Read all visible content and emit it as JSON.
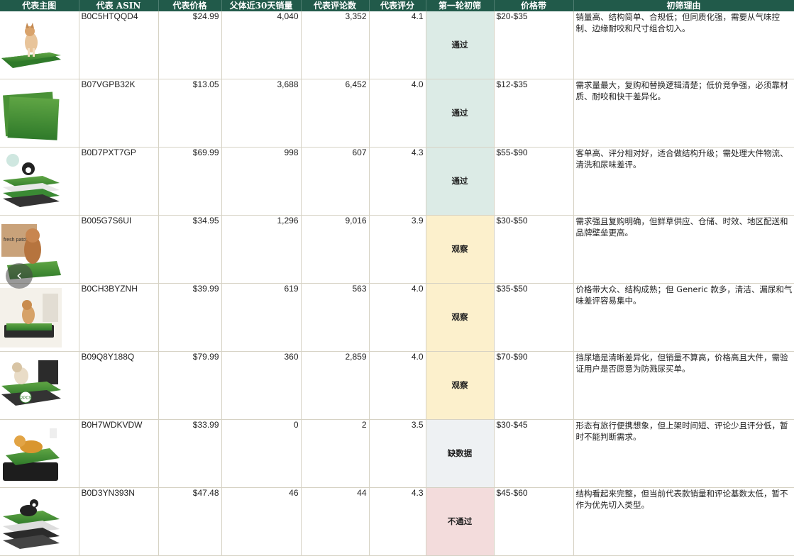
{
  "headers": [
    "代表主图",
    "代表 ASIN",
    "代表价格",
    "父体近30天销量",
    "代表评论数",
    "代表评分",
    "第一轮初筛",
    "价格带",
    "初筛理由"
  ],
  "status_colors": {
    "pass": "#dcebe6",
    "watch": "#fcf0cc",
    "missing": "#eef1f3",
    "fail": "#f3dcdc"
  },
  "nav": {
    "prev_symbol": "‹"
  },
  "rows": [
    {
      "image": "dog-on-grass-pad",
      "asin": "B0C5HTQQD4",
      "price": "$24.99",
      "sales": "4,040",
      "reviews": "3,352",
      "rating": "4.1",
      "status": "通过",
      "status_type": "pass",
      "price_band": "$20-$35",
      "reason": "销量高、结构简单、合规低；但同质化强，需要从气味控制、边缘耐咬和尺寸组合切入。"
    },
    {
      "image": "two-grass-mats",
      "asin": "B07VGPB32K",
      "price": "$13.05",
      "sales": "3,688",
      "reviews": "6,452",
      "rating": "4.0",
      "status": "通过",
      "status_type": "pass",
      "price_band": "$12-$35",
      "reason": "需求量最大，复购和替换逻辑清楚；低价竞争强，必须靠材质、耐咬和快干差异化。"
    },
    {
      "image": "layered-potty-system",
      "asin": "B0D7PXT7GP",
      "price": "$69.99",
      "sales": "998",
      "reviews": "607",
      "rating": "4.3",
      "status": "通过",
      "status_type": "pass",
      "price_band": "$55-$90",
      "reason": "客单高、评分相对好，适合做结构升级；需处理大件物流、清洗和尿味差评。"
    },
    {
      "image": "fresh-patch-box",
      "asin": "B005G7S6UI",
      "price": "$34.95",
      "sales": "1,296",
      "reviews": "9,016",
      "rating": "3.9",
      "status": "观察",
      "status_type": "watch",
      "price_band": "$30-$50",
      "reason": "需求强且复购明确，但鲜草供应、仓储、时效、地区配送和品牌壁垒更高。"
    },
    {
      "image": "dog-on-tray-indoor",
      "asin": "B0CH3BYZNH",
      "price": "$39.99",
      "sales": "619",
      "reviews": "563",
      "rating": "4.0",
      "status": "观察",
      "status_type": "watch",
      "price_band": "$35-$50",
      "reason": "价格带大众、结构成熟；但 Generic 款多，清洁、漏尿和气味差评容易集中。"
    },
    {
      "image": "dog-with-splash-wall",
      "asin": "B09Q8Y188Q",
      "price": "$79.99",
      "sales": "360",
      "reviews": "2,859",
      "rating": "4.0",
      "status": "观察",
      "status_type": "watch",
      "price_band": "$70-$90",
      "reason": "挡尿墙是清晰差异化，但销量不算高，价格高且大件，需验证用户是否愿意为防溅尿买单。"
    },
    {
      "image": "golden-retriever-tray",
      "asin": "B0H7WDKVDW",
      "price": "$33.99",
      "sales": "0",
      "reviews": "2",
      "rating": "3.5",
      "status": "缺数据",
      "status_type": "missing",
      "price_band": "$30-$45",
      "reason": "形态有旅行便携想象，但上架时间短、评论少且评分低，暂时不能判断需求。"
    },
    {
      "image": "border-collie-layered",
      "asin": "B0D3YN393N",
      "price": "$47.48",
      "sales": "46",
      "reviews": "44",
      "rating": "4.3",
      "status": "不通过",
      "status_type": "fail",
      "price_band": "$45-$60",
      "reason": "结构看起来完整，但当前代表款销量和评论基数太低，暂不作为优先切入类型。"
    }
  ]
}
